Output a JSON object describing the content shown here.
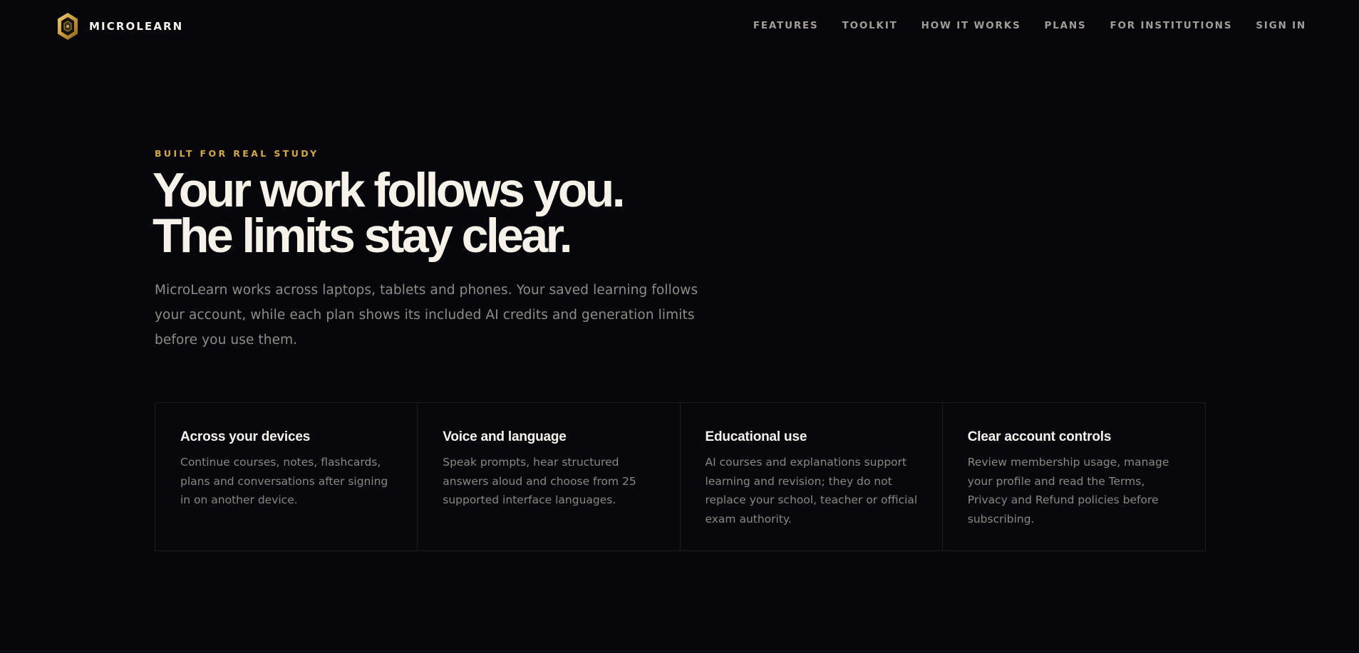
{
  "brand": {
    "name": "MICROLEARN",
    "logo_icon": "hexagon-logo-icon",
    "accent_color": "#d3a94a"
  },
  "nav": {
    "items": [
      {
        "label": "FEATURES"
      },
      {
        "label": "TOOLKIT"
      },
      {
        "label": "HOW IT WORKS"
      },
      {
        "label": "PLANS"
      },
      {
        "label": "FOR INSTITUTIONS"
      },
      {
        "label": "SIGN IN"
      }
    ]
  },
  "hero": {
    "eyebrow": "BUILT FOR REAL STUDY",
    "headline_line1": "Your work follows you.",
    "headline_line2": "The limits stay clear.",
    "lead": "MicroLearn works across laptops, tablets and phones. Your saved learning follows your account, while each plan shows its included AI credits and generation limits before you use them."
  },
  "features": [
    {
      "title": "Across your devices",
      "body": "Continue courses, notes, flashcards, plans and conversations after signing in on another device."
    },
    {
      "title": "Voice and language",
      "body": "Speak prompts, hear structured answers aloud and choose from 25 supported interface languages."
    },
    {
      "title": "Educational use",
      "body": "AI courses and explanations support learning and revision; they do not replace your school, teacher or official exam authority."
    },
    {
      "title": "Clear account controls",
      "body": "Review membership usage, manage your profile and read the Terms, Privacy and Refund policies before subscribing."
    }
  ],
  "colors": {
    "background": "#07070b",
    "headline": "#f6f2e9",
    "muted_text": "#8f8c88",
    "nav_text": "#a19e99",
    "border": "#1c1c21"
  }
}
